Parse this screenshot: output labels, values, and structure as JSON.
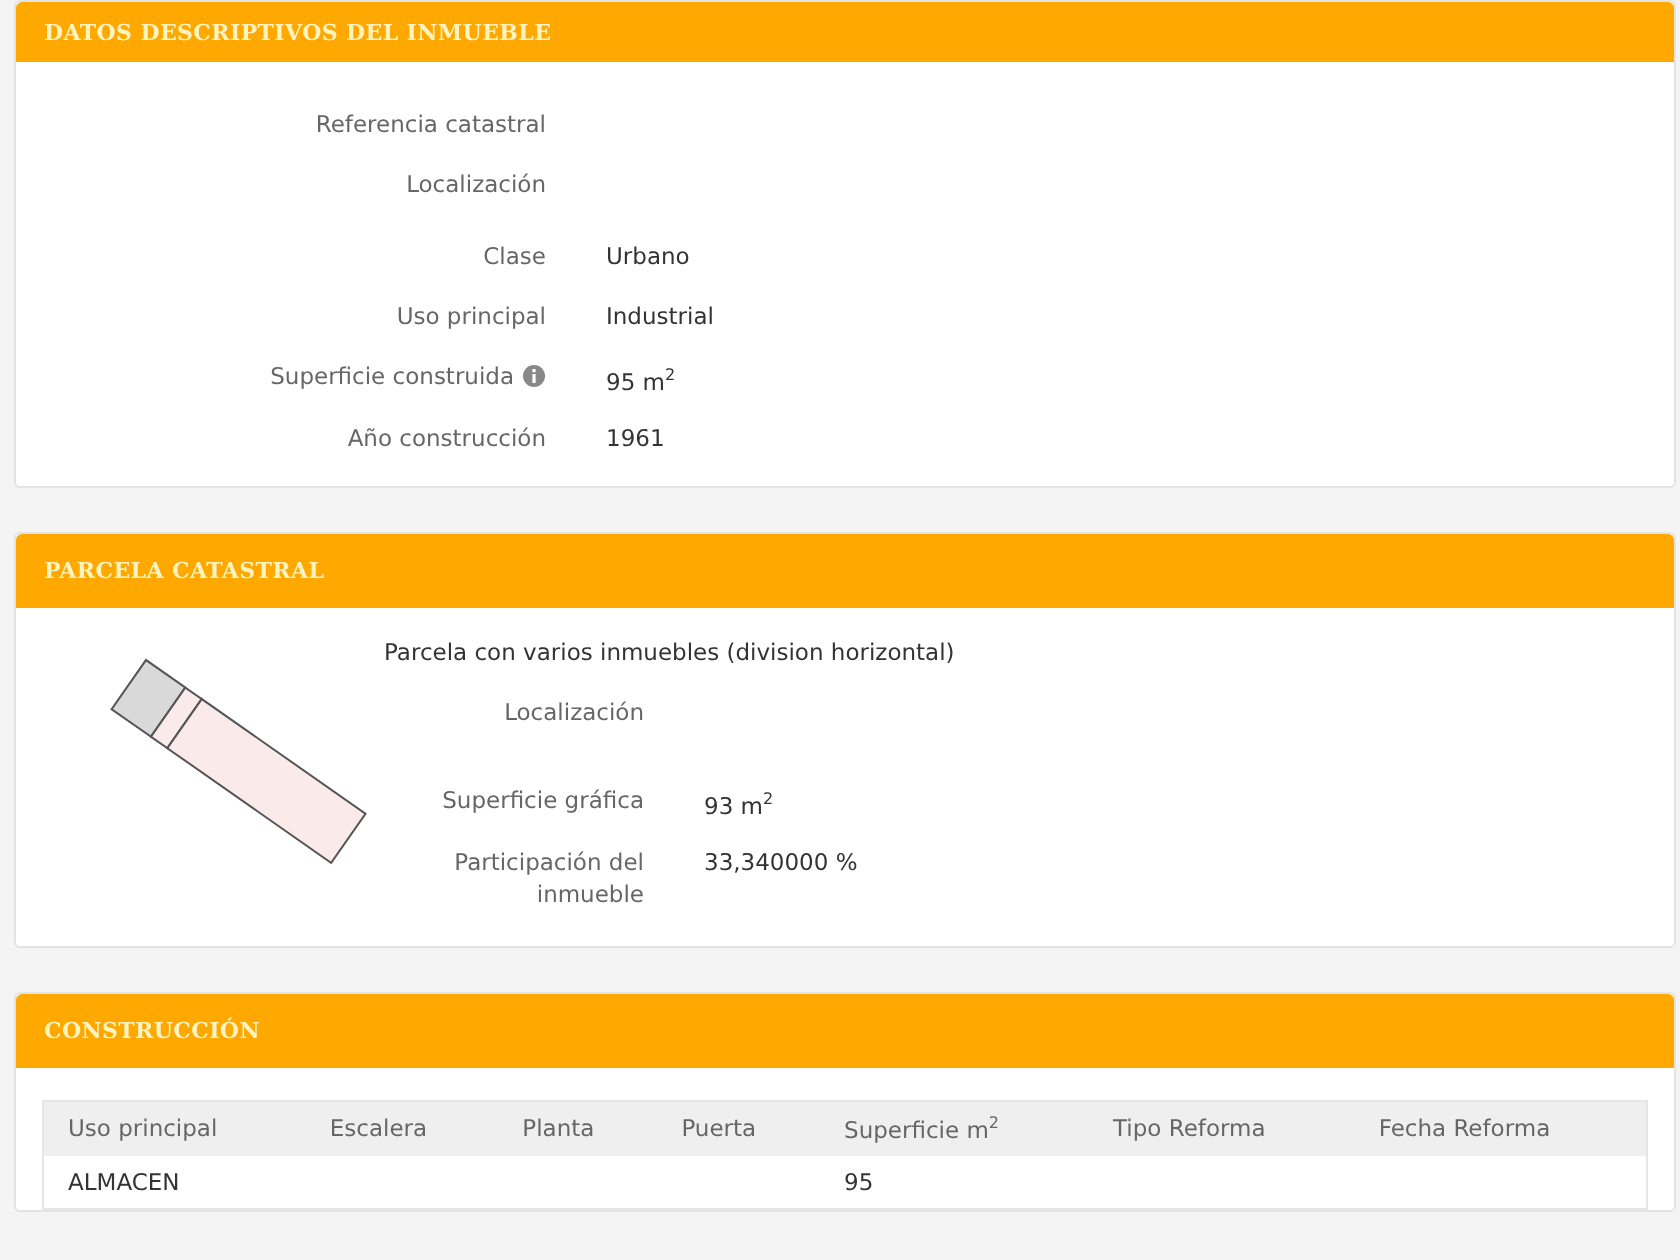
{
  "datos": {
    "title": "DATOS DESCRIPTIVOS DEL INMUEBLE",
    "groups": [
      [
        {
          "label": "Referencia catastral",
          "has_info": false
        },
        {
          "label": "Localización",
          "has_info": false
        }
      ],
      [
        {
          "label": "Clase",
          "value": "Urbano",
          "has_info": false
        },
        {
          "label": "Uso principal",
          "value": "Industrial",
          "has_info": false
        },
        {
          "label": "Superficie construida",
          "value": "95 m$^{2}$",
          "has_info": true
        },
        {
          "label": "Año construcción",
          "value": "1961",
          "has_info": false
        }
      ]
    ]
  },
  "parcela": {
    "title": "PARCELA CATASTRAL",
    "description": "Parcela con varios inmuebles (division horizontal)",
    "groups": [
      [
        {
          "label": "Localización"
        }
      ],
      [
        {
          "label": "Superficie gráfica",
          "value": "93 m$^{2}$"
        },
        {
          "label": "Participación del inmueble",
          "value": "33,340000 %"
        }
      ]
    ]
  },
  "construccion": {
    "title": "CONSTRUCCIÓN",
    "table": {
      "columns": [
        "Uso principal",
        "Escalera",
        "Planta",
        "Puerta",
        "Superficie m$^{2}$",
        "Tipo Reforma",
        "Fecha Reforma"
      ],
      "rows": [
        [
          "ALMACEN",
          "",
          "",
          "",
          "95",
          "",
          ""
        ]
      ]
    }
  }
}
